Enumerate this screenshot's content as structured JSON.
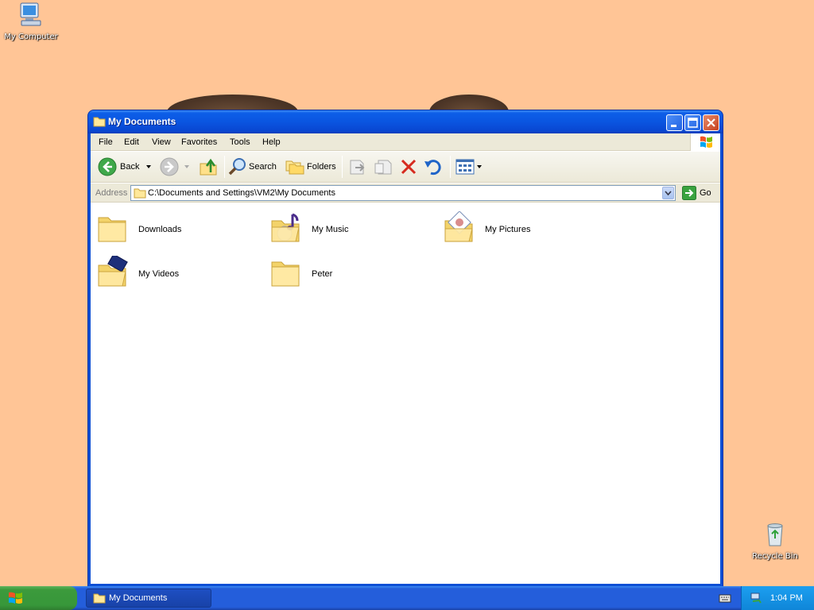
{
  "desktop": {
    "icons": [
      {
        "label": "My Computer",
        "icon": "my-computer-icon"
      },
      {
        "label": "Recycle Bin",
        "icon": "recycle-bin-icon"
      }
    ]
  },
  "window": {
    "title": "My Documents",
    "menu": [
      "File",
      "Edit",
      "View",
      "Favorites",
      "Tools",
      "Help"
    ],
    "toolbar": {
      "back_label": "Back",
      "search_label": "Search",
      "folders_label": "Folders"
    },
    "address": {
      "label": "Address",
      "value": "C:\\Documents and Settings\\VM2\\My Documents",
      "go_label": "Go"
    },
    "folders": [
      {
        "name": "Downloads",
        "icon": "folder-icon"
      },
      {
        "name": "My Music",
        "icon": "music-folder-icon"
      },
      {
        "name": "My Pictures",
        "icon": "pictures-folder-icon"
      },
      {
        "name": "My Videos",
        "icon": "videos-folder-icon"
      },
      {
        "name": "Peter",
        "icon": "folder-icon"
      }
    ]
  },
  "taskbar": {
    "task_label": "My Documents",
    "clock": "1:04 PM"
  },
  "colors": {
    "desktop": "#ffc596",
    "title_bar": "#0a55e0",
    "start_button": "#3c9a3c",
    "taskbar": "#245edb"
  }
}
